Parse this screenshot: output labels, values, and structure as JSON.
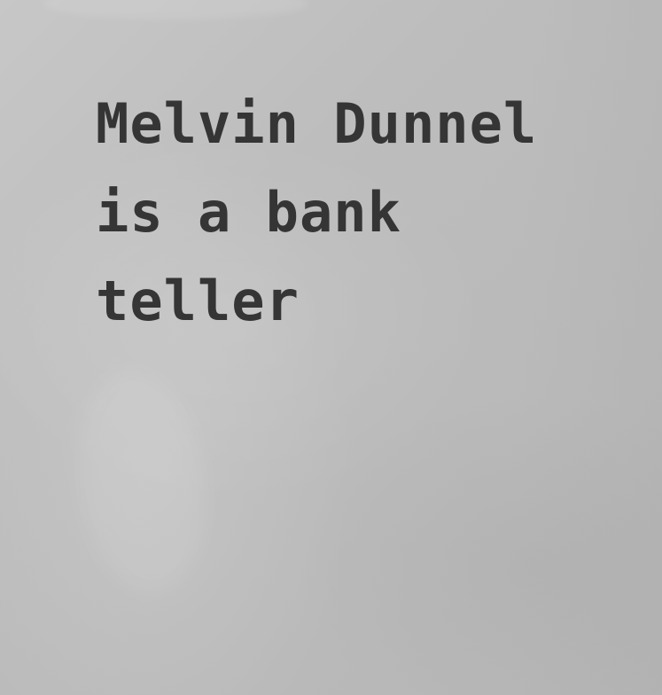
{
  "card": {
    "lines": [
      "Melvin Dunnel",
      "is a bank",
      "teller"
    ]
  },
  "colors": {
    "background": "#c0c0c0",
    "text": "#353535"
  }
}
